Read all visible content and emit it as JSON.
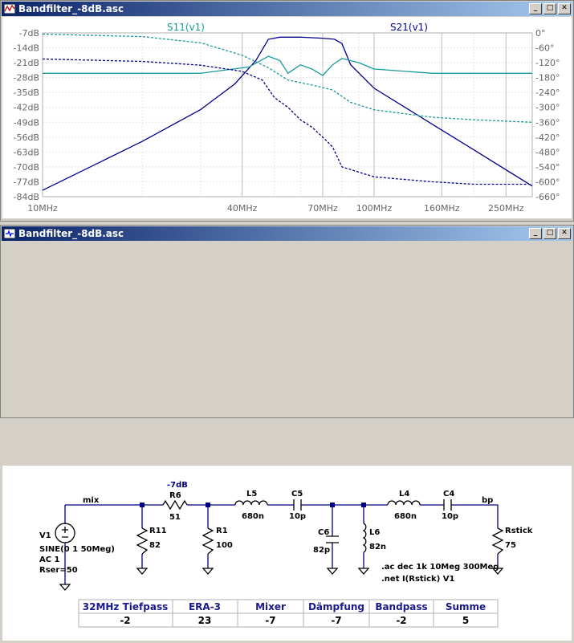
{
  "plot_window": {
    "title": "Bandfilter_-8dB.asc",
    "trace_left": "S11(v1)",
    "trace_right": "S21(v1)",
    "y_left_ticks": [
      "-7dB",
      "-14dB",
      "-21dB",
      "-28dB",
      "-35dB",
      "-42dB",
      "-49dB",
      "-56dB",
      "-63dB",
      "-70dB",
      "-77dB",
      "-84dB"
    ],
    "y_right_ticks": [
      "0°",
      "-60°",
      "-120°",
      "-180°",
      "-240°",
      "-300°",
      "-360°",
      "-420°",
      "-480°",
      "-540°",
      "-600°",
      "-660°"
    ],
    "x_ticks": [
      "10MHz",
      "40MHz",
      "70MHz",
      "100MHz",
      "160MHz",
      "250MHz"
    ]
  },
  "chart_data": {
    "type": "line",
    "x_scale": "log",
    "xlim_mhz": [
      10,
      300
    ],
    "ylim_db": [
      -84,
      -7
    ],
    "ylim_deg": [
      -660,
      0
    ],
    "grid": true,
    "series": [
      {
        "name": "S21(v1)",
        "quantity": "magnitude",
        "x": [
          10,
          20,
          30,
          38,
          44,
          48,
          52,
          60,
          70,
          76,
          80,
          85,
          100,
          150,
          200,
          300
        ],
        "y": [
          -81,
          -58,
          -43,
          -31,
          -20,
          -10,
          -9,
          -9,
          -9.5,
          -10,
          -12,
          -22,
          -33,
          -50,
          -62,
          -79
        ]
      },
      {
        "name": "S11(v1)",
        "quantity": "magnitude",
        "x": [
          10,
          30,
          42,
          48,
          52,
          55,
          60,
          65,
          70,
          75,
          80,
          90,
          100,
          150,
          200,
          300
        ],
        "y": [
          -26,
          -26,
          -23,
          -18,
          -20,
          -26,
          -22,
          -24,
          -27,
          -22,
          -19,
          -21,
          -24,
          -26,
          -26,
          -26
        ]
      },
      {
        "name": "S21(v1)",
        "quantity": "phase",
        "x": [
          10,
          20,
          30,
          40,
          46,
          50,
          55,
          60,
          65,
          70,
          75,
          80,
          100,
          150,
          200,
          300
        ],
        "y": [
          -105,
          -115,
          -130,
          -155,
          -190,
          -260,
          -300,
          -350,
          -380,
          -420,
          -460,
          -540,
          -580,
          -600,
          -610,
          -610
        ]
      },
      {
        "name": "S11(v1)",
        "quantity": "phase",
        "x": [
          10,
          20,
          30,
          40,
          48,
          55,
          65,
          75,
          85,
          100,
          150,
          200,
          300
        ],
        "y": [
          -5,
          -15,
          -40,
          -90,
          -140,
          -190,
          -210,
          -230,
          -280,
          -310,
          -340,
          -350,
          -360
        ]
      }
    ]
  },
  "schematic_window": {
    "title": "Bandfilter_-8dB.asc",
    "labels": {
      "mix": "mix",
      "bp": "bp",
      "r6_ann": "-7dB",
      "r6": "R6",
      "r6v": "51",
      "r11": "R11",
      "r11v": "82",
      "r1": "R1",
      "r1v": "100",
      "l5": "L5",
      "l5v": "680n",
      "c5": "C5",
      "c5v": "10p",
      "c6": "C6",
      "c6v": "82p",
      "l6": "L6",
      "l6v": "82n",
      "l4": "L4",
      "l4v": "680n",
      "c4": "C4",
      "c4v": "10p",
      "rs": "Rstick",
      "rsv": "75",
      "v1": "V1",
      "v1a": "SINE(0 1 50Meg)",
      "v1b": "AC 1",
      "v1c": "Rser=50",
      "dir1": ".ac dec 1k 10Meg 300Meg",
      "dir2": ".net I(Rstick) V1"
    },
    "table": {
      "headers": [
        "32MHz Tiefpass",
        "ERA-3",
        "Mixer",
        "Dämpfung",
        "Bandpass",
        "Summe"
      ],
      "values": [
        "-2",
        "23",
        "-7",
        "-7",
        "-2",
        "5"
      ]
    }
  }
}
